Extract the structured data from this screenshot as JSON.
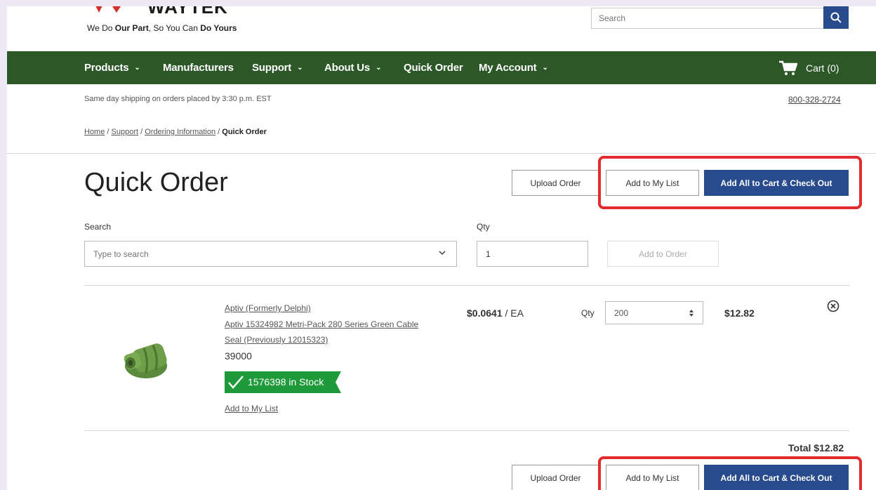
{
  "header": {
    "logo_text": "WAYTEK",
    "tagline_part1": "We Do ",
    "tagline_bold1": "Our Part",
    "tagline_part2": ", So You Can ",
    "tagline_bold2": "Do Yours",
    "search_placeholder": "Search",
    "search_icon": "search-icon"
  },
  "nav": {
    "items": [
      {
        "label": "Products",
        "has_dropdown": true
      },
      {
        "label": "Manufacturers",
        "has_dropdown": false
      },
      {
        "label": "Support",
        "has_dropdown": true
      },
      {
        "label": "About Us",
        "has_dropdown": true
      },
      {
        "label": "Quick Order",
        "has_dropdown": false
      },
      {
        "label": "My Account",
        "has_dropdown": true
      }
    ],
    "cart_label": "Cart (0)",
    "cart_icon": "cart-icon",
    "bg_color": "#2c5727"
  },
  "info": {
    "shipping": "Same day shipping on orders placed by 3:30 p.m. EST",
    "phone": "800-328-2724"
  },
  "breadcrumb": {
    "items": [
      "Home",
      "Support",
      "Ordering Information"
    ],
    "separator": " / ",
    "current": "Quick Order"
  },
  "page": {
    "title": "Quick Order",
    "upload_order": "Upload Order",
    "add_to_my_list": "Add to My List",
    "add_all_checkout": "Add All to Cart & Check Out"
  },
  "form": {
    "search_label": "Search",
    "search_placeholder": "Type to search",
    "qty_label": "Qty",
    "qty_value": "1",
    "add_to_order": "Add to Order"
  },
  "item": {
    "manufacturer": "Aptiv (Formerly Delphi)",
    "name_line1": "Aptiv 15324982 Metri-Pack 280 Series Green Cable",
    "name_line2": "Seal (Previously 12015323)",
    "part_number": "39000",
    "stock": "1576398 in Stock",
    "add_to_my_list": "Add to My List",
    "price": "$0.0641",
    "unit": " / EA",
    "qty_label": "Qty",
    "qty_value": "200",
    "line_total": "$12.82"
  },
  "summary": {
    "total": "Total $12.82"
  },
  "colors": {
    "accent": "#274b8c",
    "nav_green": "#2c5727",
    "stock_green": "#1f9a3a",
    "highlight": "#e32a2c"
  }
}
